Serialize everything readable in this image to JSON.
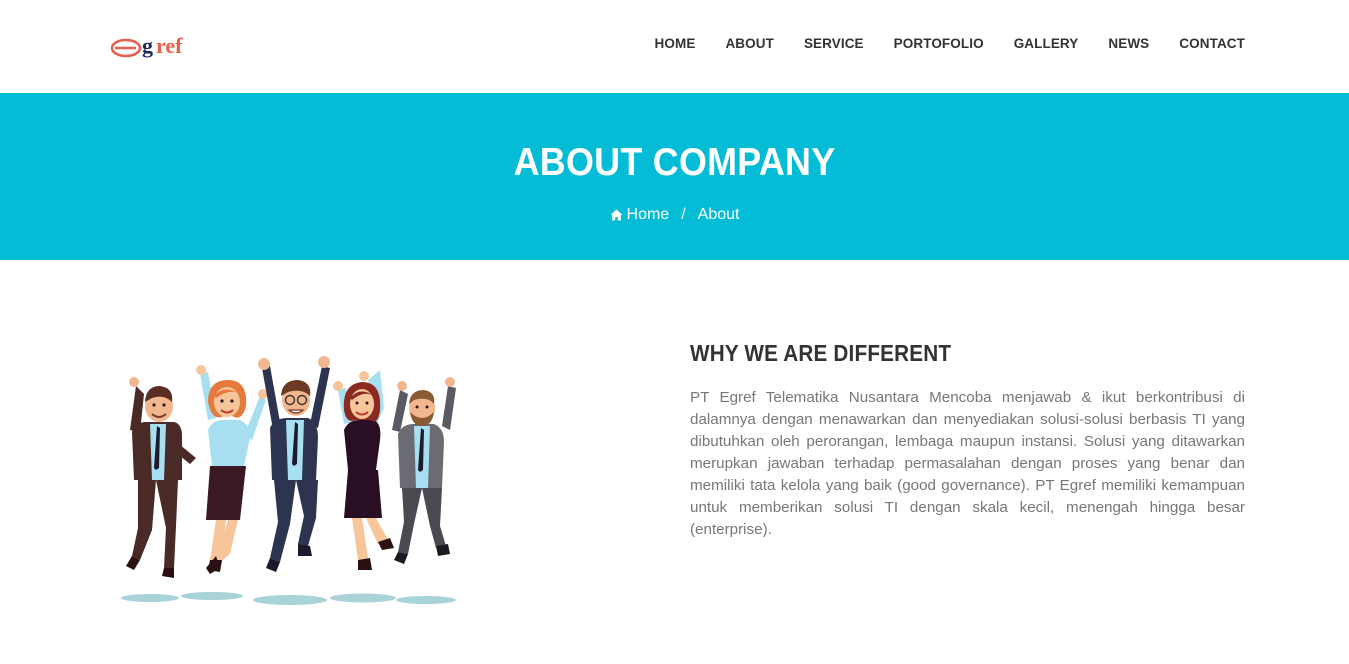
{
  "brand": {
    "logo_text": "egref",
    "logo_icon": "egref-logo"
  },
  "nav": {
    "items": [
      {
        "label": "HOME"
      },
      {
        "label": "ABOUT"
      },
      {
        "label": "SERVICE"
      },
      {
        "label": "PORTOFOLIO"
      },
      {
        "label": "GALLERY"
      },
      {
        "label": "NEWS"
      },
      {
        "label": "CONTACT"
      }
    ]
  },
  "hero": {
    "title": "ABOUT COMPANY",
    "breadcrumb": {
      "home_icon": "home-icon",
      "home_label": "Home",
      "separator": "/",
      "current": "About"
    }
  },
  "about": {
    "heading": "WHY WE ARE DIFFERENT",
    "body": "PT Egref Telematika Nusantara Mencoba menjawab & ikut berkontribusi di dalamnya dengan menawarkan dan menyediakan solusi-solusi berbasis TI yang dibutuhkan oleh perorangan, lembaga maupun instansi. Solusi yang ditawarkan merupkan jawaban terhadap permasalahan dengan proses yang benar dan memiliki tata kelola yang baik (good governance). PT Egref memiliki kemampuan untuk memberikan solusi TI dengan skala kecil, menengah hingga besar (enterprise).",
    "illustration": "jumping-team-illustration"
  },
  "colors": {
    "accent": "#05bcd6",
    "heading": "#333333",
    "text": "#777777",
    "logo_red": "#e8604c",
    "logo_navy": "#1f2a5a"
  }
}
